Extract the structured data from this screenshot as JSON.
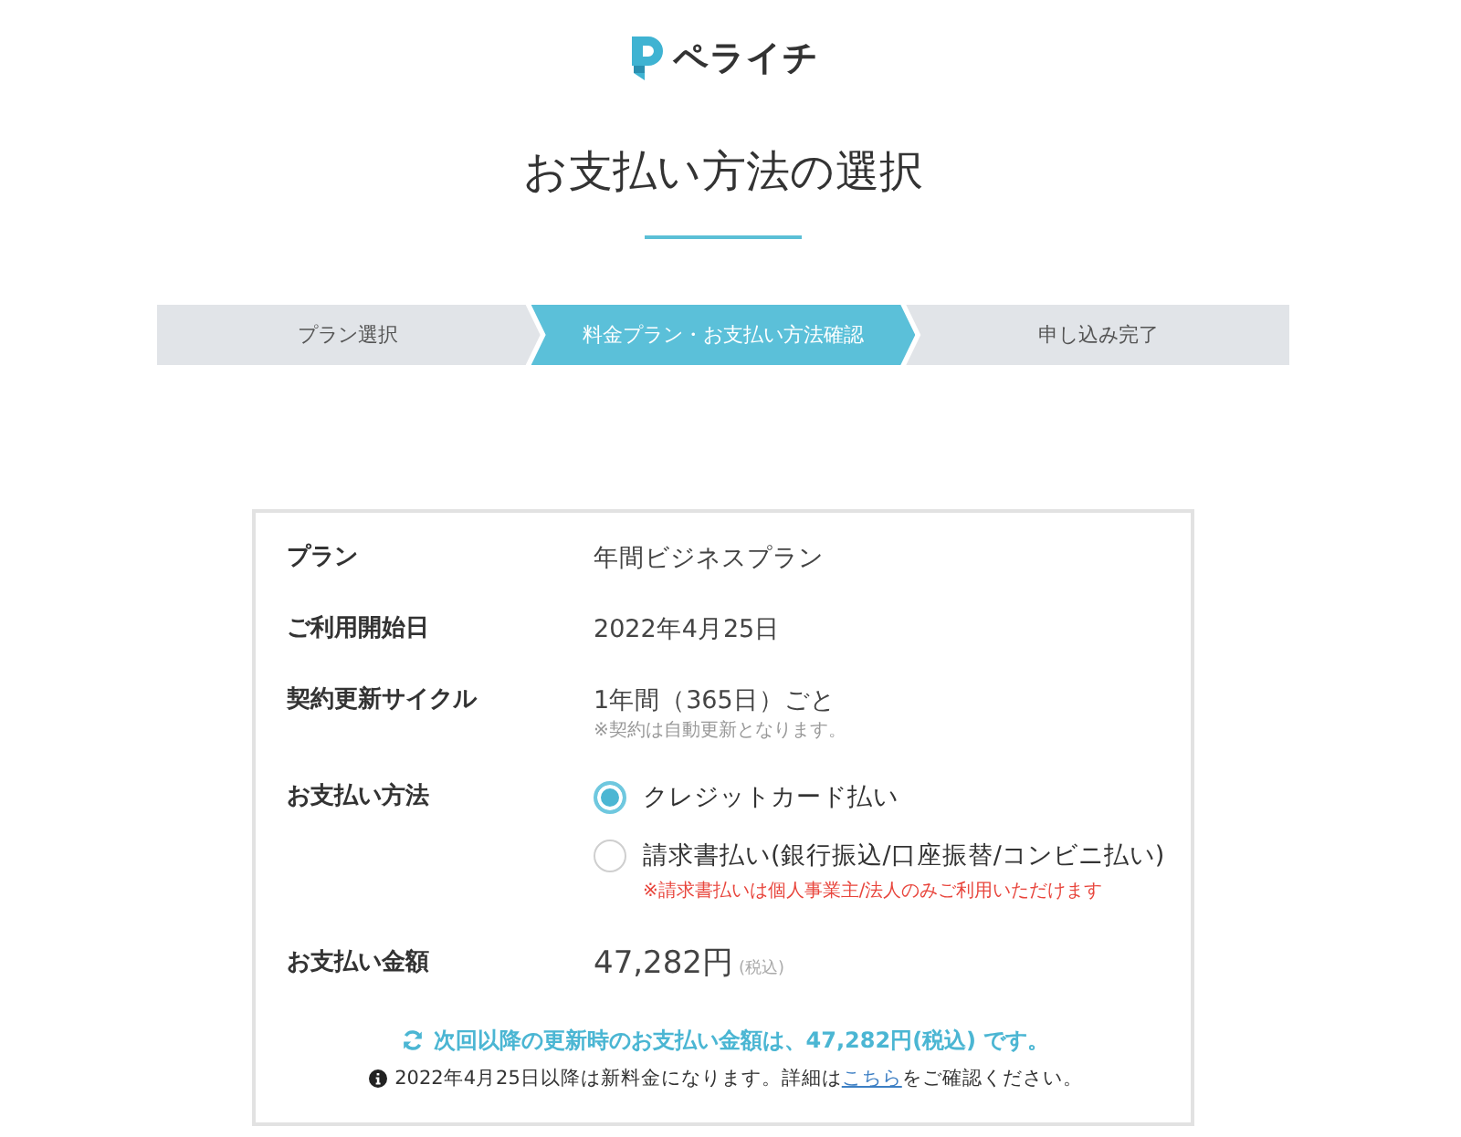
{
  "logo": {
    "text": "ペライチ"
  },
  "title": "お支払い方法の選択",
  "steps": [
    {
      "label": "プラン選択",
      "selected": false
    },
    {
      "label": "料金プラン・お支払い方法確認",
      "selected": true
    },
    {
      "label": "申し込み完了",
      "selected": false
    }
  ],
  "details": [
    {
      "label": "プラン",
      "value": "年間ビジネスプラン"
    },
    {
      "label": "ご利用開始日",
      "value": "2022年4月25日"
    },
    {
      "label": "契約更新サイクル",
      "value": "1年間（365日）ごと",
      "note": "※契約は自動更新となります。"
    }
  ],
  "payment_method": {
    "label": "お支払い方法",
    "options": [
      {
        "label": "クレジットカード払い",
        "selected": true
      },
      {
        "label": "請求書払い(銀行振込/口座振替/コンビニ払い)",
        "selected": false,
        "note": "※請求書払いは個人事業主/法人のみご利用いただけます"
      }
    ]
  },
  "amount": {
    "label": "お支払い金額",
    "value": "47,282円",
    "tax": "(税込)"
  },
  "renewal_notice": "次回以降の更新時のお支払い金額は、47,282円(税込) です。",
  "info_notice": {
    "before": "2022年4月25日以降は新料金になります。詳細は",
    "link": "こちら",
    "after": "をご確認ください。"
  }
}
